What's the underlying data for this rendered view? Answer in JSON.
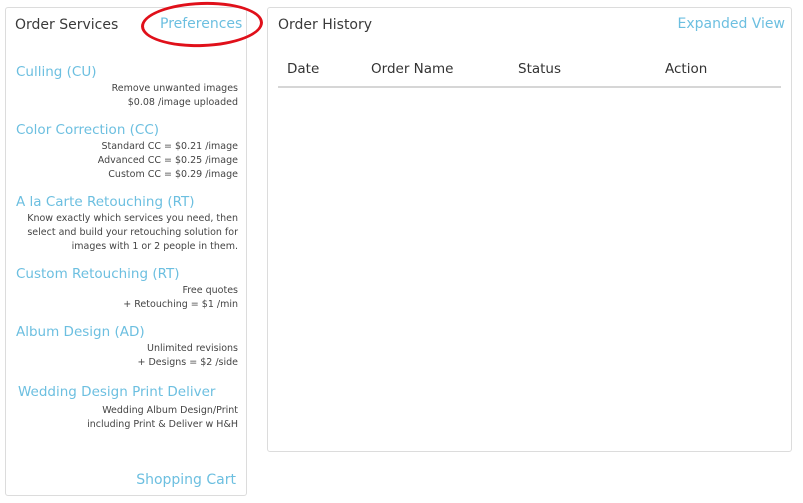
{
  "services_panel": {
    "title": "Order Services",
    "preferences_link": "Preferences",
    "shopping_cart_link": "Shopping Cart",
    "services": [
      {
        "name": "Culling (CU)",
        "desc": [
          "Remove unwanted images",
          "$0.08 /image uploaded"
        ]
      },
      {
        "name": "Color Correction (CC)",
        "desc": [
          "Standard CC = $0.21 /image",
          "Advanced CC = $0.25 /image",
          "Custom CC = $0.29 /image"
        ]
      },
      {
        "name": "A la Carte Retouching (RT)",
        "desc_text": "Know exactly which services you need, then select and build your retouching solution for images with 1 or 2 people in them."
      },
      {
        "name": "Custom Retouching (RT)",
        "desc": [
          "Free quotes",
          "+ Retouching = $1 /min"
        ]
      },
      {
        "name": "Album Design (AD)",
        "desc": [
          "Unlimited revisions",
          "+ Designs = $2 /side"
        ]
      },
      {
        "name": "Wedding Design Print Deliver",
        "desc": [
          "Wedding Album Design/Print",
          "including Print & Deliver w H&H"
        ]
      }
    ]
  },
  "history_panel": {
    "title": "Order History",
    "expanded_view_link": "Expanded View",
    "columns": [
      "Date",
      "Order Name",
      "Status",
      "Action"
    ]
  },
  "colors": {
    "link": "#6cbfe0",
    "highlight_circle": "#e0101a",
    "border": "#dcdcdc"
  }
}
